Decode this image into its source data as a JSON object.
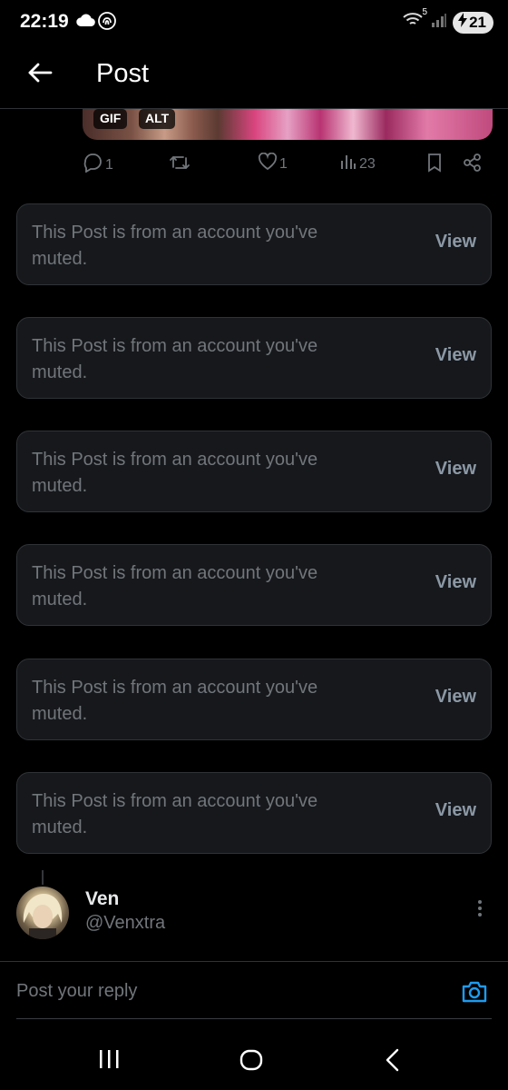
{
  "status_bar": {
    "time": "22:19",
    "signal_badge": "5",
    "battery_level": "21",
    "icons": [
      "cloud-icon",
      "fingerprint-icon",
      "wifi-icon",
      "cell-signal-icon",
      "battery-charging-icon"
    ]
  },
  "header": {
    "title": "Post"
  },
  "media": {
    "gif_label": "GIF",
    "alt_label": "ALT"
  },
  "actions": {
    "reply_count": "1",
    "like_count": "1",
    "views_count": "23"
  },
  "muted_posts": [
    {
      "text": "This Post is from an account you've muted.",
      "action": "View"
    },
    {
      "text": "This Post is from an account you've muted.",
      "action": "View"
    },
    {
      "text": "This Post is from an account you've muted.",
      "action": "View"
    },
    {
      "text": "This Post is from an account you've muted.",
      "action": "View"
    },
    {
      "text": "This Post is from an account you've muted.",
      "action": "View"
    },
    {
      "text": "This Post is from an account you've muted.",
      "action": "View"
    }
  ],
  "reply": {
    "name": "Ven",
    "handle": "@Venxtra"
  },
  "compose": {
    "placeholder": "Post your reply"
  },
  "colors": {
    "background": "#000000",
    "card": "#16181c",
    "muted_text": "#71767b",
    "accent": "#1d9bf0"
  }
}
